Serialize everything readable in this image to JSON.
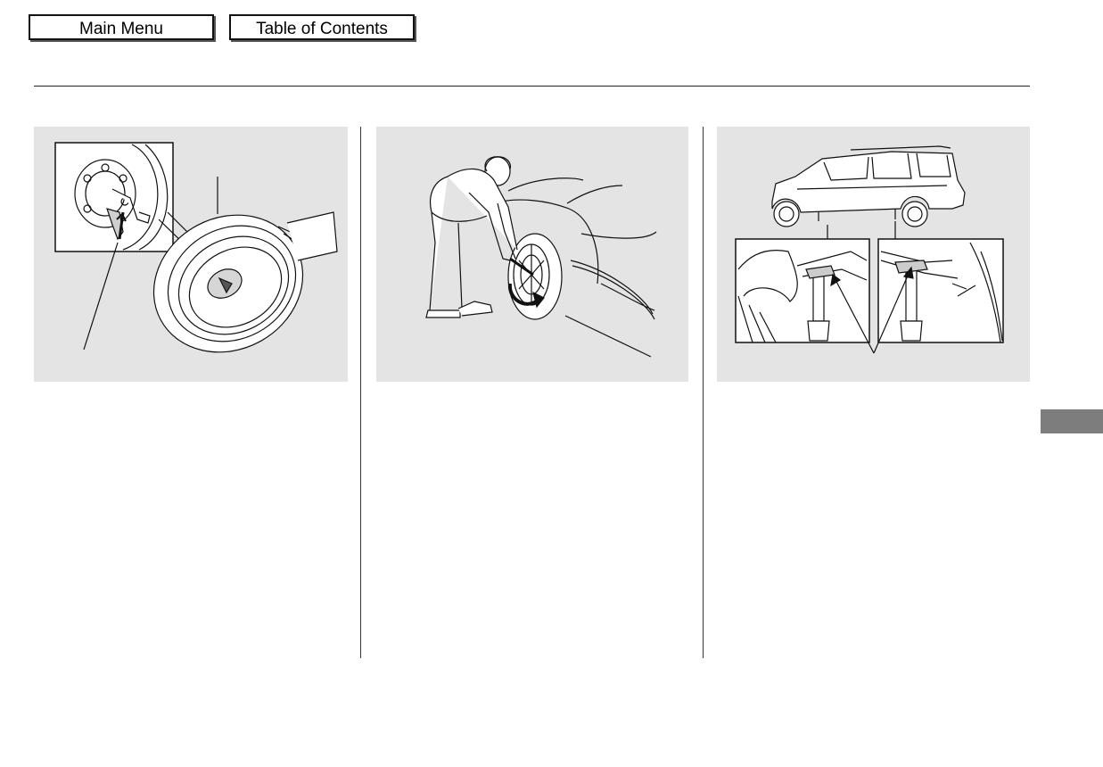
{
  "nav": {
    "main_menu_label": "Main Menu",
    "toc_label": "Table of Contents"
  },
  "figures": [
    {
      "icon": "spare-tire-removal-illustration"
    },
    {
      "icon": "wheel-nut-loosening-illustration"
    },
    {
      "icon": "vehicle-jack-points-illustration"
    }
  ],
  "colors": {
    "panel_background": "#e4e4e4",
    "side_tab": "#7d7d7d",
    "line": "#222222"
  }
}
